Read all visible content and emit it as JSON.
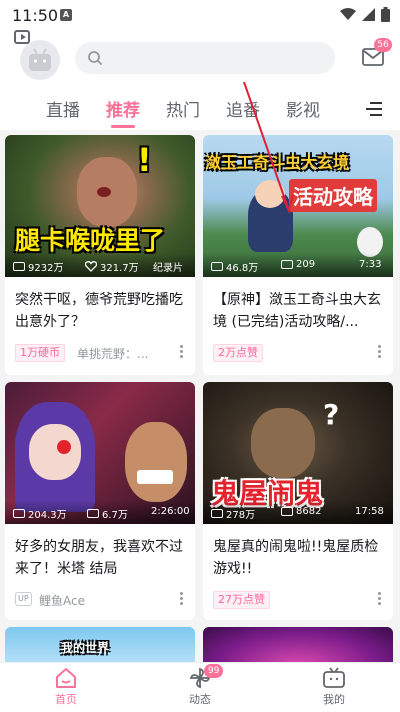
{
  "status_bar": {
    "time": "11:50",
    "notif_letter": "A"
  },
  "header": {
    "message_badge": "56"
  },
  "tabs": [
    {
      "label": "直播",
      "active": false
    },
    {
      "label": "推荐",
      "active": true
    },
    {
      "label": "热门",
      "active": false
    },
    {
      "label": "追番",
      "active": false
    },
    {
      "label": "影视",
      "active": false
    }
  ],
  "cards": [
    {
      "overlay_text": "腿卡喉咙里了",
      "views": "9232万",
      "likes": "321.7万",
      "badge": "纪录片",
      "title": "突然干呕，德爷荒野吃播吃出意外了？",
      "tag": "1万硬币",
      "uploader": "单挑荒野：..."
    },
    {
      "overlay_text_1": "潋玉工奇斗虫大玄境",
      "overlay_text_2": "活动攻略",
      "views": "46.8万",
      "danmaku": "209",
      "duration": "7:33",
      "title": "【原神】潋玉工奇斗虫大玄境 (已完结)活动攻略/...",
      "tag": "2万点赞"
    },
    {
      "views": "204.3万",
      "danmaku": "6.7万",
      "duration": "2:26:00",
      "title": "好多的女朋友，我喜欢不过来了！米塔 结局",
      "uploader_badge": "UP",
      "uploader": "鲤鱼Ace"
    },
    {
      "overlay_text": "鬼屋闹鬼",
      "views": "278万",
      "danmaku": "8682",
      "duration": "17:58",
      "title": "鬼屋真的闹鬼啦!!鬼屋质检游戏!!",
      "tag": "27万点赞"
    }
  ],
  "partial_cards": [
    {
      "overlay_text": "我的世界"
    }
  ],
  "bottom_nav": [
    {
      "label": "首页",
      "active": true
    },
    {
      "label": "动态",
      "active": false,
      "badge": "99"
    },
    {
      "label": "我的",
      "active": false
    }
  ],
  "colors": {
    "accent": "#fb7299",
    "arrow": "#e0203a"
  }
}
